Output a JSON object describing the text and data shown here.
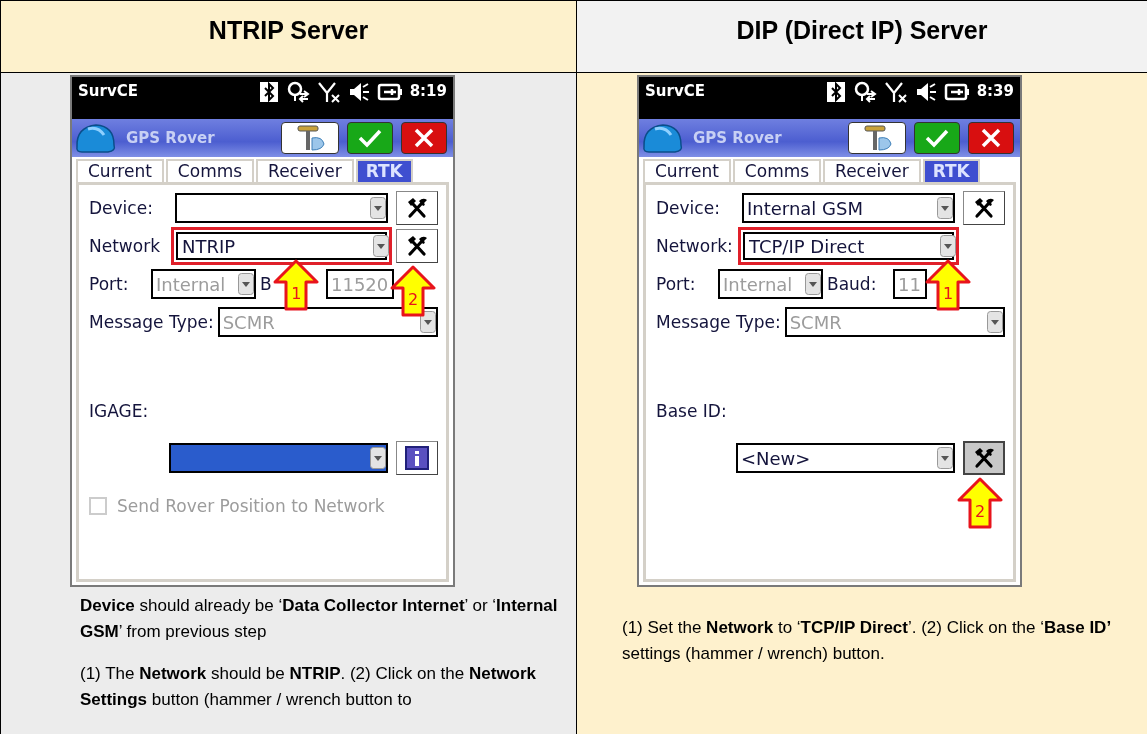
{
  "columns": [
    {
      "title": "NTRIP Server",
      "phone": {
        "app": "SurvCE",
        "time": "8:19",
        "title": "GPS Rover",
        "tabs": [
          {
            "label": "Current",
            "selected": false
          },
          {
            "label": "Comms",
            "selected": false
          },
          {
            "label": "Receiver",
            "selected": false
          },
          {
            "label": "RTK",
            "selected": true
          }
        ],
        "rows": [
          {
            "kind": "select",
            "label": "Device:",
            "value": "",
            "highlighted": false,
            "tool": {
              "kind": "hammer",
              "pressed": false
            }
          },
          {
            "kind": "select",
            "label": "Network",
            "value": "NTRIP",
            "highlighted": true,
            "disabled": false,
            "tool": {
              "kind": "hammer",
              "pressed": false
            },
            "callouts": [
              {
                "number": "1",
                "kind": "field"
              },
              {
                "number": "2",
                "kind": "tool"
              }
            ]
          },
          {
            "kind": "pair",
            "label": "Port:",
            "value": "Internal",
            "label_2": "B",
            "value_2": "11520",
            "disabled": true
          },
          {
            "kind": "select",
            "label": "Message Type:",
            "value": "SCMR",
            "highlighted": false,
            "disabled": true
          },
          {
            "kind": "label",
            "label": "IGAGE:"
          },
          {
            "kind": "wide_select",
            "value": "",
            "focused": true,
            "tool": {
              "kind": "info",
              "pressed": false
            }
          },
          {
            "kind": "checkbox",
            "label": "Send Rover Position to Network",
            "checked": false,
            "disabled": true
          }
        ]
      },
      "notes": [
        "**Device** should already be ‘**Data Collector Internet**’ or ‘**Internal GSM**’ from previous step",
        "(1) The **Network** should be **NTRIP**. (2) Click on the **Network Settings** button (hammer / wrench button to"
      ]
    },
    {
      "title": "DIP (Direct IP) Server",
      "phone": {
        "app": "SurvCE",
        "time": "8:39",
        "title": "GPS Rover",
        "tabs": [
          {
            "label": "Current",
            "selected": false
          },
          {
            "label": "Comms",
            "selected": false
          },
          {
            "label": "Receiver",
            "selected": false
          },
          {
            "label": "RTK",
            "selected": true
          }
        ],
        "rows": [
          {
            "kind": "select",
            "label": "Device:",
            "value": "Internal GSM",
            "highlighted": false,
            "disabled": false,
            "tool": {
              "kind": "hammer",
              "pressed": false
            }
          },
          {
            "kind": "select",
            "label": "Network:",
            "value": "TCP/IP Direct",
            "highlighted": true,
            "disabled": false,
            "callouts": [
              {
                "number": "1",
                "kind": "field_end"
              }
            ]
          },
          {
            "kind": "pair",
            "label": "Port:",
            "value": "Internal",
            "label_2": "Baud:",
            "value_2": "11",
            "disabled": true
          },
          {
            "kind": "select",
            "label": "Message Type:",
            "value": "SCMR",
            "highlighted": false,
            "disabled": true
          },
          {
            "kind": "label",
            "label": "Base ID:"
          },
          {
            "kind": "wide_select",
            "value": "<New>",
            "focused": false,
            "tool": {
              "kind": "hammer",
              "pressed": true
            },
            "callouts": [
              {
                "number": "2",
                "kind": "tool"
              }
            ]
          }
        ]
      },
      "notes": [
        "(1) Set the **Network** to ‘**TCP/IP Direct**’. (2) Click on the ‘**Base ID’** settings (hammer / wrench) button."
      ]
    }
  ]
}
